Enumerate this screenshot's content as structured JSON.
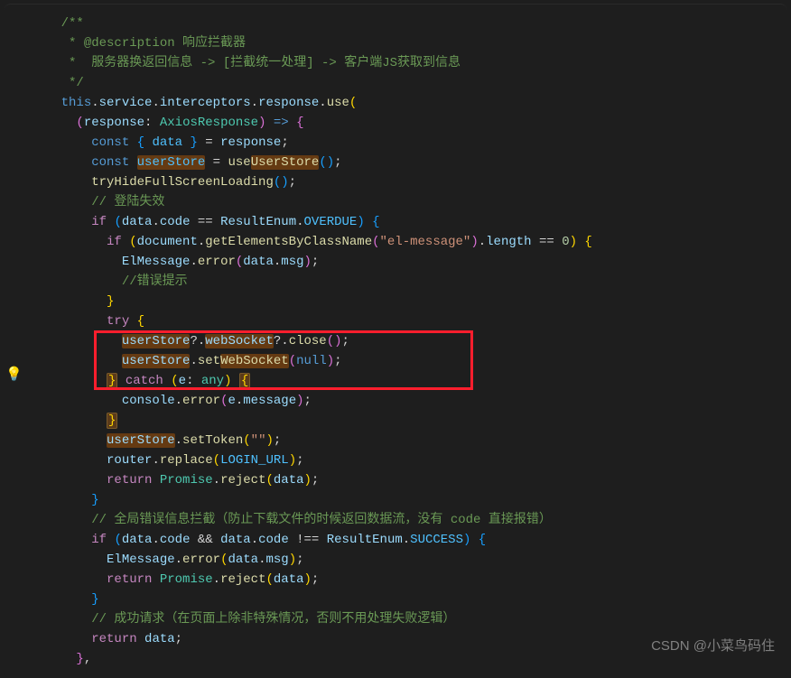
{
  "comment_block": {
    "l1": "/**",
    "l2": " * @description 响应拦截器",
    "l3": " *  服务器换返回信息 -> [拦截统一处理] -> 客户端JS获取到信息",
    "l4": " */"
  },
  "code": {
    "this": "this",
    "dot": ".",
    "service": "service",
    "interceptors": "interceptors",
    "response": "response",
    "use": "use",
    "oparen": "(",
    "cparen": ")",
    "obrace": "{",
    "cbrace": "}",
    "semi": ";",
    "colon": ":",
    "comma": ",",
    "arrow": "=>",
    "responseParam": "response",
    "axiosType": "AxiosResponse",
    "const": "const",
    "data": "data",
    "eq": "=",
    "eqeq": "==",
    "neqeq": "!==",
    "andand": "&&",
    "userStore": "userStore",
    "useUserStore": "UserStore",
    "usePrefix": "use",
    "tryHide": "tryHideFullScreenLoading",
    "comment_login": "// 登陆失效",
    "if": "if",
    "code": "code",
    "resultEnum": "ResultEnum",
    "overdue": "OVERDUE",
    "document": "document",
    "getByClass": "getElementsByClassName",
    "elMessageStr": "\"el-message\"",
    "length": "length",
    "zero": "0",
    "elMessage": "ElMessage",
    "error": "error",
    "msg": "msg",
    "comment_err": "//错误提示",
    "try": "try",
    "catch": "catch",
    "eVar": "e",
    "anyType": "any",
    "opt": "?",
    "optDot": "?.",
    "webSocket": "webSocket",
    "close": "close",
    "setWebSocket": "WebSocket",
    "setPrefix": "set",
    "null": "null",
    "console": "console",
    "message": "message",
    "setToken": "setToken",
    "emptyStr": "\"\"",
    "router": "router",
    "replace": "replace",
    "loginUrl": "LOGIN_URL",
    "return": "return",
    "promise": "Promise",
    "reject": "reject",
    "comment_global": "// 全局错误信息拦截（防止下载文件的时候返回数据流，没有 code 直接报错）",
    "success": "SUCCESS",
    "comment_ok": "// 成功请求（在页面上除非特殊情况，否则不用处理失败逻辑）"
  },
  "watermark": "CSDN @小菜鸟码住"
}
